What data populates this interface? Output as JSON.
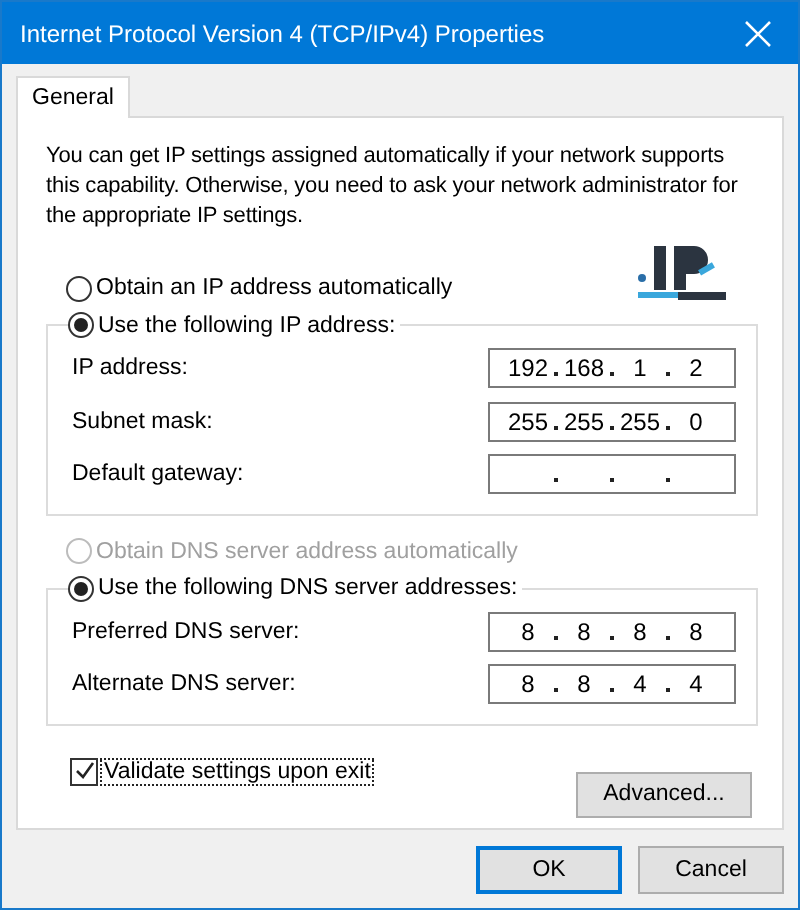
{
  "window": {
    "title": "Internet Protocol Version 4 (TCP/IPv4) Properties"
  },
  "tabs": [
    {
      "label": "General",
      "selected": true
    }
  ],
  "description": "You can get IP settings assigned automatically if your network supports this capability. Otherwise, you need to ask your network administrator for the appropriate IP settings.",
  "sections": [
    {
      "auto": {
        "label": "Obtain an IP address automatically",
        "selected": false,
        "disabled": false
      },
      "manual": {
        "label": "Use the following IP address:",
        "selected": true,
        "disabled": false,
        "fields": [
          {
            "label": "IP address:",
            "octets": [
              "192",
              "168",
              "1",
              "2"
            ]
          },
          {
            "label": "Subnet mask:",
            "octets": [
              "255",
              "255",
              "255",
              "0"
            ]
          },
          {
            "label": "Default gateway:"
          }
        ]
      }
    },
    {
      "auto": {
        "label": "Obtain DNS server address automatically",
        "selected": false,
        "disabled": true
      },
      "manual": {
        "label": "Use the following DNS server addresses:",
        "selected": true,
        "disabled": false,
        "fields": [
          {
            "label": "Preferred DNS server:",
            "octets": [
              "8",
              "8",
              "8",
              "8"
            ]
          },
          {
            "label": "Alternate DNS server:",
            "octets": [
              "8",
              "8",
              "4",
              "4"
            ]
          }
        ]
      }
    }
  ],
  "validate": {
    "label": "Validate settings upon exit",
    "checked": true,
    "focused": true
  },
  "advanced_button": "Advanced...",
  "buttons": [
    {
      "label": "OK",
      "default": true
    },
    {
      "label": "Cancel",
      "default": false
    }
  ]
}
